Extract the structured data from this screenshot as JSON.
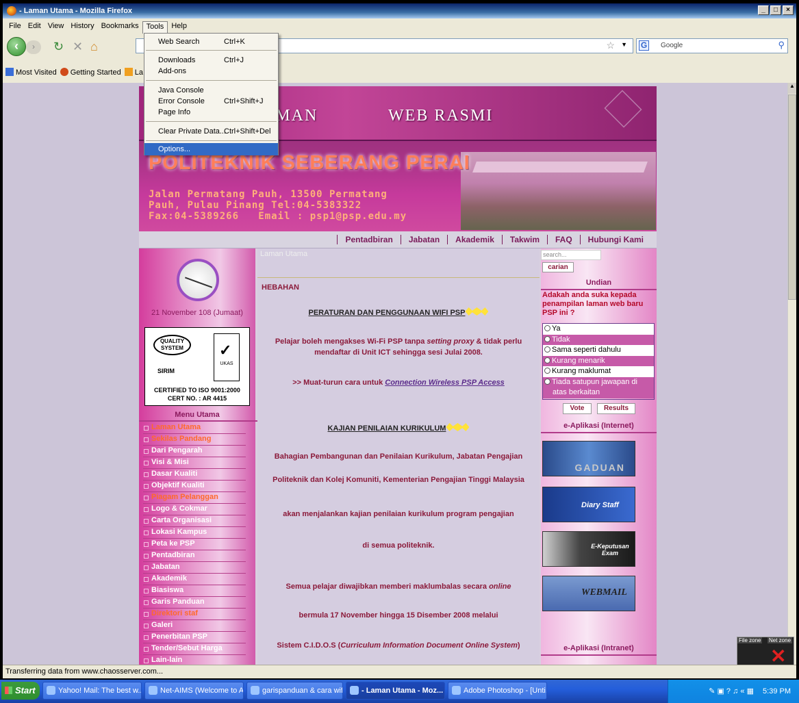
{
  "window": {
    "title": "- Laman Utama - Mozilla Firefox",
    "controls": [
      "_",
      "□",
      "×"
    ]
  },
  "menubar": [
    "File",
    "Edit",
    "View",
    "History",
    "Bookmarks",
    "Tools",
    "Help"
  ],
  "navbar": {
    "url": "",
    "search_engine": "Google"
  },
  "bookmarks": [
    "Most Visited",
    "Getting Started",
    "La"
  ],
  "tools_menu": {
    "web_search": {
      "label": "Web Search",
      "shortcut": "Ctrl+K"
    },
    "downloads": {
      "label": "Downloads",
      "shortcut": "Ctrl+J"
    },
    "addons": {
      "label": "Add-ons"
    },
    "java_console": {
      "label": "Java Console"
    },
    "error_console": {
      "label": "Error Console",
      "shortcut": "Ctrl+Shift+J"
    },
    "page_info": {
      "label": "Page Info"
    },
    "clear_private": {
      "label": "Clear Private Data...",
      "shortcut": "Ctrl+Shift+Del"
    },
    "options": {
      "label": "Options..."
    }
  },
  "banner": {
    "title_left": "AMAN",
    "title_right": "WEB RASMI",
    "name": "POLITEKNIK SEBERANG PERAI",
    "address": [
      "Jalan Permatang Pauh, 13500 Permatang",
      "Pauh, Pulau Pinang Tel:04-5383322",
      "Fax:04-5389266   Email : psp1@psp.edu.my"
    ]
  },
  "topnav": [
    "Pentadbiran",
    "Jabatan",
    "Akademik",
    "Takwim",
    "FAQ",
    "Hubungi Kami"
  ],
  "left": {
    "date": "21 November 108 (Jumaat)",
    "cert": {
      "quality": "QUALITY SYSTEM",
      "sirim": "SIRIM",
      "ukas": "UKAS",
      "line1": "CERTIFIED TO ISO 9001:2000",
      "line2": "CERT NO. : AR 4415"
    },
    "menu_title": "Menu Utama",
    "menu": [
      {
        "label": "Laman Utama",
        "hl": true
      },
      {
        "label": "Sekilas Pandang",
        "hl": true
      },
      {
        "label": "Dari Pengarah",
        "hl": false
      },
      {
        "label": "Visi & Misi",
        "hl": false
      },
      {
        "label": "Dasar Kualiti",
        "hl": false
      },
      {
        "label": "Objektif Kualiti",
        "hl": false
      },
      {
        "label": "Piagam Pelanggan",
        "hl": true
      },
      {
        "label": "Logo & Cokmar",
        "hl": false
      },
      {
        "label": "Carta Organisasi",
        "hl": false
      },
      {
        "label": "Lokasi Kampus",
        "hl": false
      },
      {
        "label": "Peta ke PSP",
        "hl": false
      },
      {
        "label": "Pentadbiran",
        "hl": false
      },
      {
        "label": "Jabatan",
        "hl": false
      },
      {
        "label": "Akademik",
        "hl": false
      },
      {
        "label": "Biasiswa",
        "hl": false
      },
      {
        "label": "Garis Panduan",
        "hl": false
      },
      {
        "label": "Direktori staf",
        "hl": true
      },
      {
        "label": "Galeri",
        "hl": false
      },
      {
        "label": "Penerbitan PSP",
        "hl": false
      },
      {
        "label": "Tender/Sebut Harga",
        "hl": false
      },
      {
        "label": "Lain-lain",
        "hl": false
      }
    ]
  },
  "center": {
    "breadcrumb": "Laman Utama",
    "heading": "HEBAHAN",
    "wifi_title": "PERATURAN DAN PENGGUNAAN WIFI PSP",
    "wifi_p1_a": "Pelajar boleh mengakses Wi-Fi PSP tanpa ",
    "wifi_p1_em": "setting proxy",
    "wifi_p1_b": " & tidak perlu",
    "wifi_p2": "mendaftar di Unit ICT sehingga sesi Julai 2008.",
    "wifi_dl": ">> Muat-turun cara untuk ",
    "wifi_link": "Connection Wireless PSP Access",
    "kaj_title": "KAJIAN PENILAIAN KURIKULUM",
    "kaj_l1": "Bahagian Pembangunan dan Penilaian Kurikulum, Jabatan Pengajian",
    "kaj_l2": "Politeknik dan Kolej Komuniti, Kementerian Pengajian Tinggi Malaysia",
    "kaj_l3": "akan menjalankan kajian penilaian kurikulum program pengajian",
    "kaj_l4": "di semua politeknik.",
    "kaj_l5a": "Semua pelajar diwajibkan memberi maklumbalas secara ",
    "kaj_l5em": "online",
    "kaj_l6": "bermula 17 November hingga 15 Disember 2008 melalui",
    "kaj_l7a": "Sistem C.I.D.O.S (",
    "kaj_l7em": "Curriculum Information Document Online System",
    "kaj_l7b": ")"
  },
  "right": {
    "search_placeholder": "search...",
    "search_btn": "carian",
    "poll_title": "Undian",
    "poll_question": "Adakah anda suka kepada penampilan laman web baru PSP ini ?",
    "poll_options": [
      "Ya",
      "Tidak",
      "Sama seperti dahulu",
      "Kurang menarik",
      "Kurang maklumat",
      "Tiada satupun jawapan di",
      "atas berkaitan"
    ],
    "vote": "Vote",
    "results": "Results",
    "eapp_internet": "e-Aplikasi (Internet)",
    "banners": [
      "GADUAN",
      "Diary Staff",
      "E-Keputusan Exam",
      "WEBMAIL"
    ],
    "eapp_intranet": "e-Aplikasi (Intranet)"
  },
  "status": "Transferring data from www.chaosserver.com...",
  "netpanel": {
    "file_zone": "File zone",
    "net_zone": "Net zone"
  },
  "taskbar": {
    "start": "Start",
    "tasks": [
      "Yahoo! Mail: The best w...",
      "Net-AIMS (Welcome to A...",
      "garispanduan & cara wifi...",
      "- Laman Utama - Moz...",
      "Adobe Photoshop - [Unti..."
    ],
    "clock": "5:39 PM"
  }
}
